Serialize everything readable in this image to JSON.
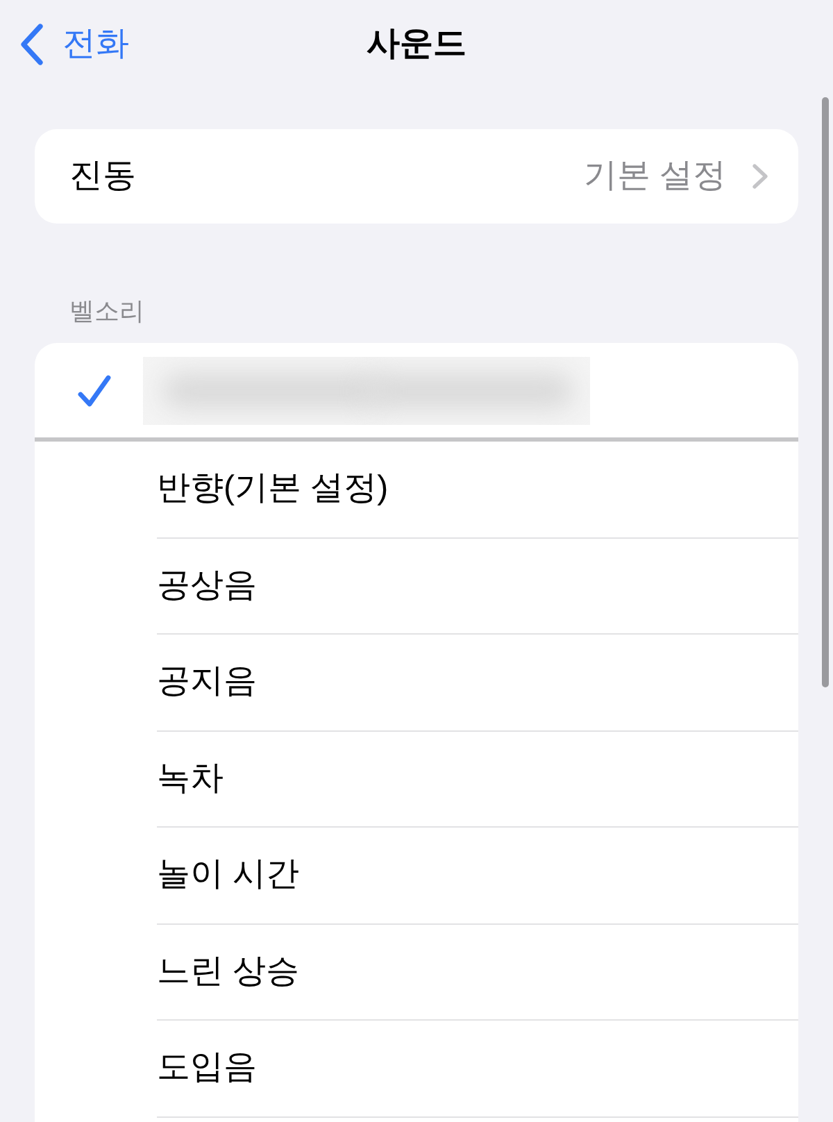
{
  "nav": {
    "back": "전화",
    "title": "사운드"
  },
  "vibration": {
    "label": "진동",
    "value": "기본 설정"
  },
  "ringtones": {
    "header": "벨소리",
    "items": [
      {
        "kind": "redacted",
        "selected": true
      },
      {
        "kind": "tone",
        "label": "반향(기본 설정)",
        "selected": false
      },
      {
        "kind": "tone",
        "label": "공상음",
        "selected": false
      },
      {
        "kind": "tone",
        "label": "공지음",
        "selected": false
      },
      {
        "kind": "tone",
        "label": "녹차",
        "selected": false
      },
      {
        "kind": "tone",
        "label": "놀이 시간",
        "selected": false
      },
      {
        "kind": "tone",
        "label": "느린 상승",
        "selected": false
      },
      {
        "kind": "tone",
        "label": "도입음",
        "selected": false
      }
    ]
  }
}
